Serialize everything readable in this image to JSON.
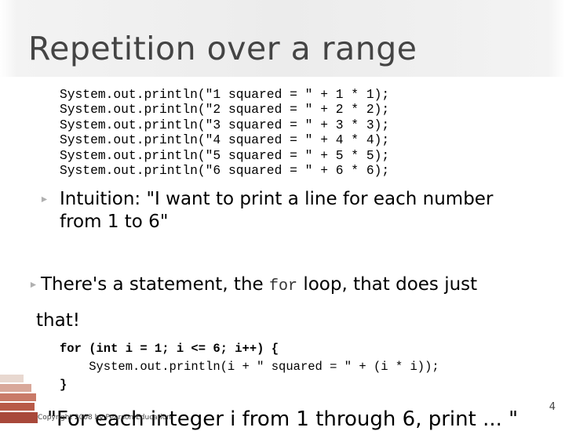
{
  "slide": {
    "title": "Repetition over a range",
    "code_lines": [
      "System.out.println(\"1 squared = \" + 1 * 1);",
      "System.out.println(\"2 squared = \" + 2 * 2);",
      "System.out.println(\"3 squared = \" + 3 * 3);",
      "System.out.println(\"4 squared = \" + 4 * 4);",
      "System.out.println(\"5 squared = \" + 5 * 5);",
      "System.out.println(\"6 squared = \" + 6 * 6);"
    ],
    "bullet1_line1": "Intuition: \"I want to print a line for each number",
    "bullet1_line2": "from 1 to 6\"",
    "bullet2_pre": "There's a statement, the ",
    "bullet2_code": "for",
    "bullet2_post": " loop, that does just",
    "bullet2_line2": "that!",
    "for_code_line1_kw": "for",
    "for_code_line1_rest": " (int i = 1; i <= 6; i++) {",
    "for_code_line2": "    System.out.println(i + \" squared = \" + (i * i));",
    "for_code_line3": "}",
    "cut_bullet_text": "\"For each integer i from 1 through 6, print ... \"",
    "footer": "Copyright 2008 by Pearson Education",
    "page_number": "4"
  },
  "colors": {
    "title": "#444444",
    "bullet_arrow": "#b0b0b0",
    "brick": "#c0392b"
  }
}
